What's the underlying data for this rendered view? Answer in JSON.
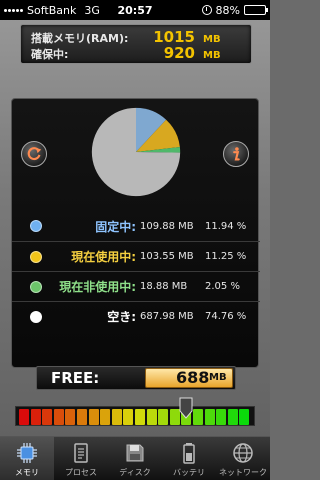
{
  "status_bar": {
    "carrier": "SoftBank",
    "network": "3G",
    "time": "20:57",
    "battery": "88%",
    "battery_level": 0.88
  },
  "ram_panel": {
    "installed_label": "搭載メモリ(RAM):",
    "installed_value": "1015",
    "installed_unit": "MB",
    "reserved_label": "確保中:",
    "reserved_value": "920",
    "reserved_unit": "MB"
  },
  "chart_data": {
    "type": "pie",
    "slices": [
      {
        "name": "固定中",
        "value": 11.94,
        "color": "#7fa8d0"
      },
      {
        "name": "現在使用中",
        "value": 11.25,
        "color": "#d8a820"
      },
      {
        "name": "現在非使用中",
        "value": 2.05,
        "color": "#4fb86a"
      },
      {
        "name": "空き",
        "value": 74.76,
        "color": "#b8b8b8"
      }
    ]
  },
  "legend": [
    {
      "label": "固定中:",
      "mb": "109.88 MB",
      "pct": "11.94 %",
      "dot": "#6fb0f0",
      "text_color": "#8fc4ff"
    },
    {
      "label": "現在使用中:",
      "mb": "103.55 MB",
      "pct": "11.25 %",
      "dot": "#f2c41a",
      "text_color": "#f5d040"
    },
    {
      "label": "現在非使用中:",
      "mb": "18.88 MB",
      "pct": "2.05 %",
      "dot": "#6cc46a",
      "text_color": "#8fe08a"
    },
    {
      "label": "空き:",
      "mb": "687.98 MB",
      "pct": "74.76 %",
      "dot": "#ffffff",
      "text_color": "#ffffff"
    }
  ],
  "free": {
    "label": "FREE:",
    "value": "688",
    "unit": "MB"
  },
  "gauge": {
    "level": 0.72
  },
  "tabs": [
    {
      "label": "メモリ",
      "icon": "chip-icon",
      "active": true
    },
    {
      "label": "プロセス",
      "icon": "document-icon",
      "active": false
    },
    {
      "label": "ディスク",
      "icon": "floppy-disk-icon",
      "active": false
    },
    {
      "label": "バッテリ",
      "icon": "battery-icon",
      "active": false
    },
    {
      "label": "ネットワーク",
      "icon": "globe-icon",
      "active": false
    }
  ]
}
